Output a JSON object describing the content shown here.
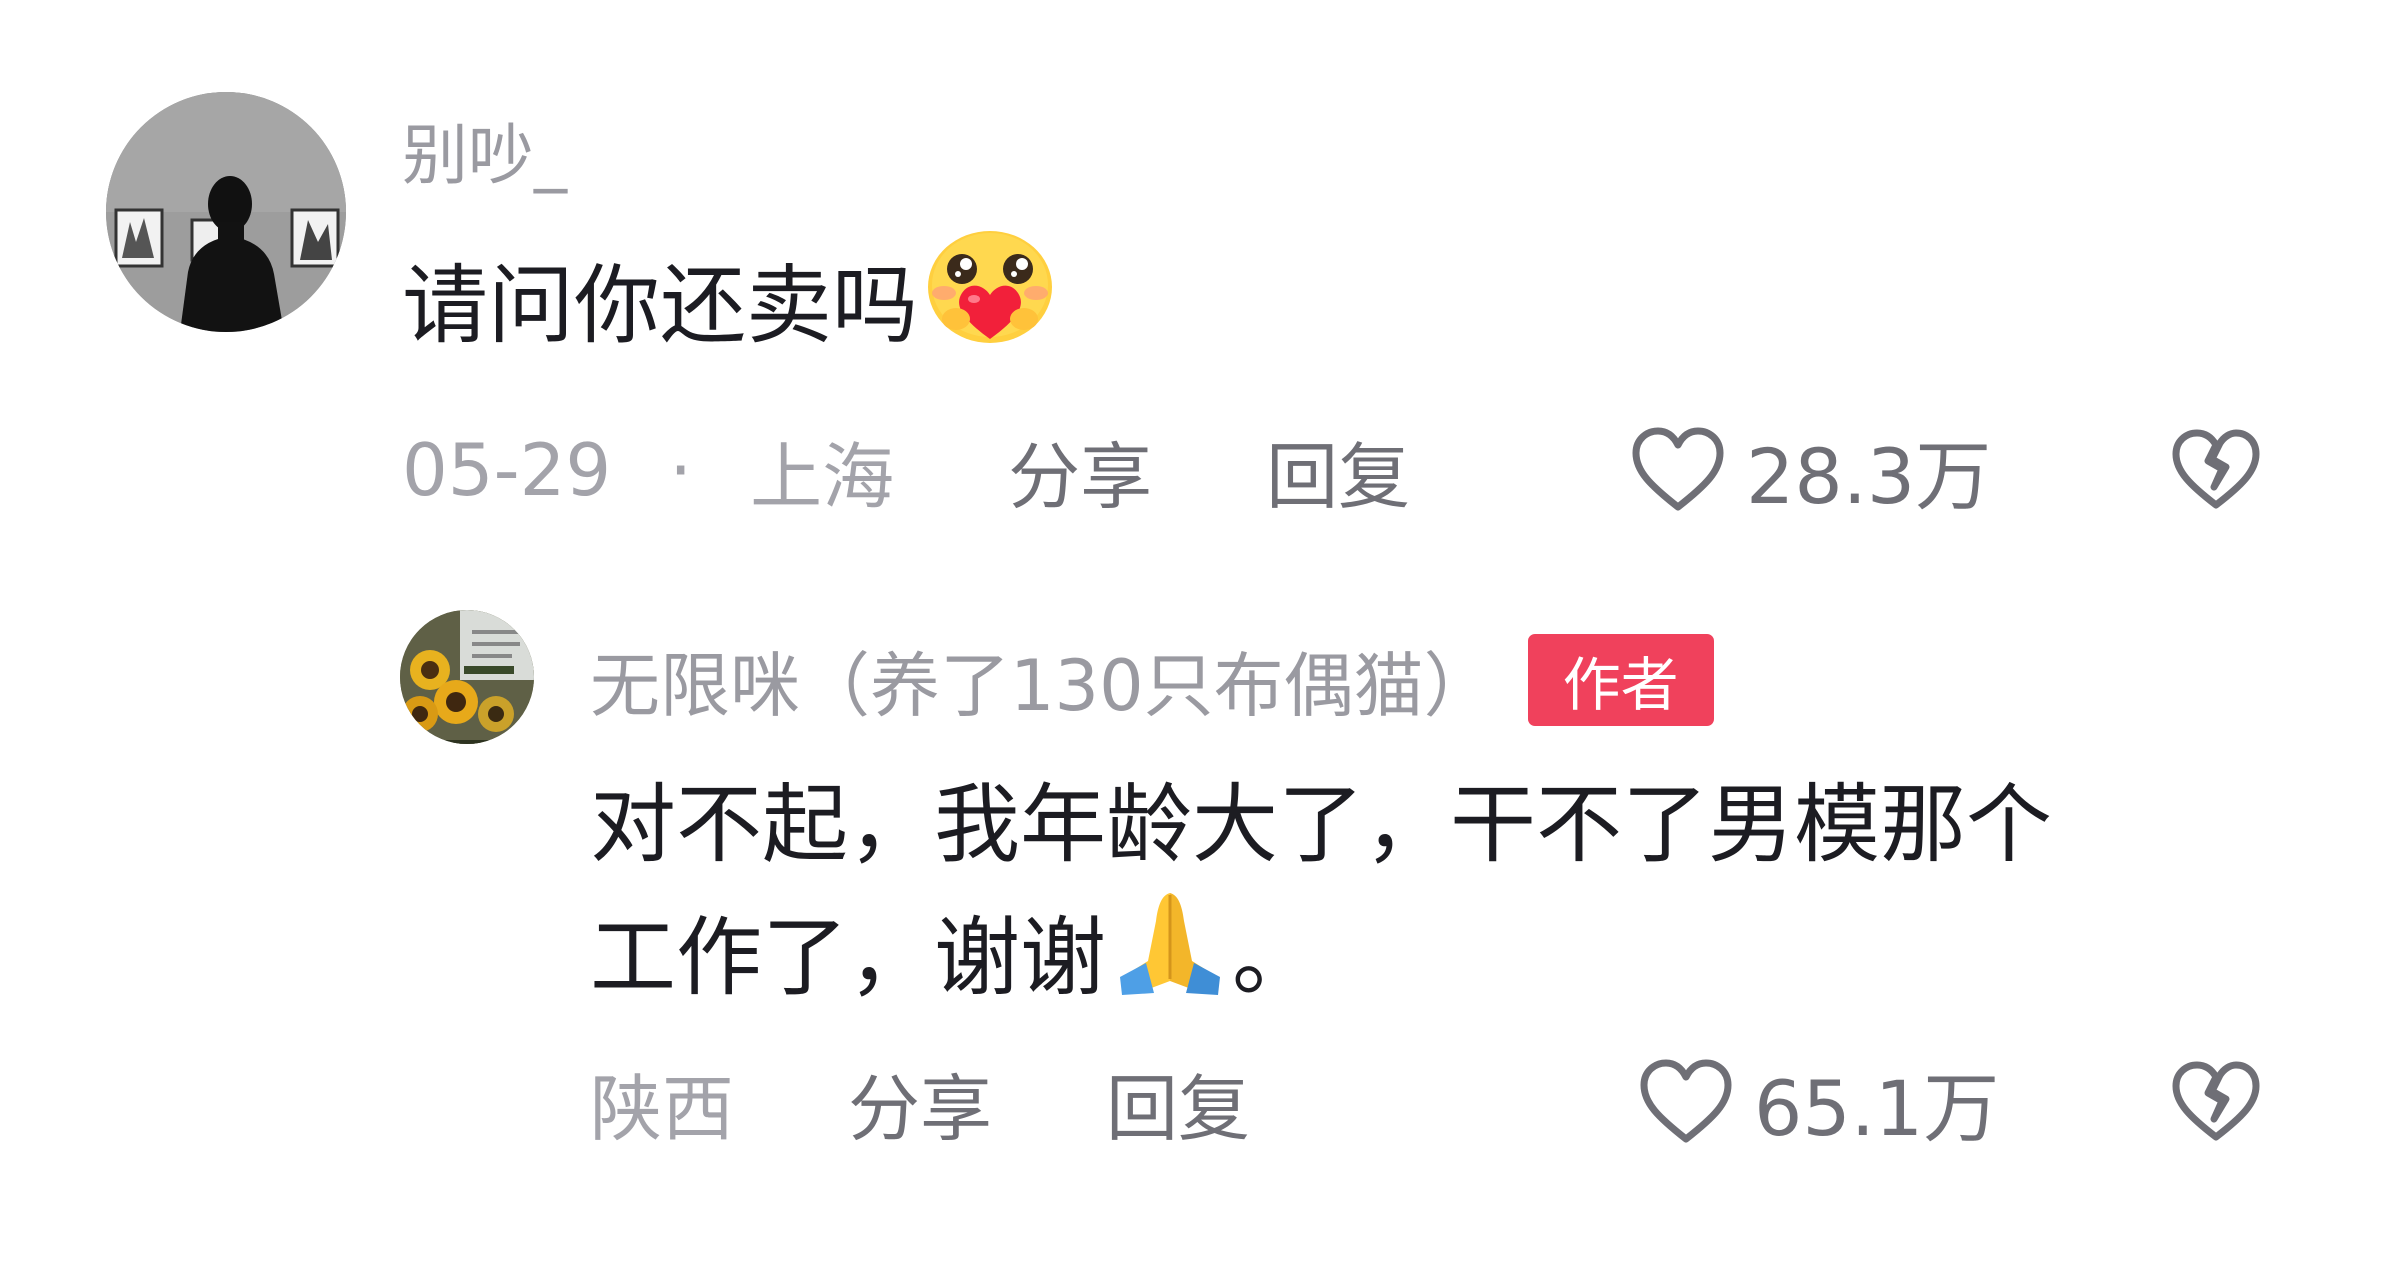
{
  "comment": {
    "username": "别吵_",
    "text": "请问你还卖吗",
    "date": "05-29",
    "separator": "·",
    "location": "上海",
    "share_label": "分享",
    "reply_label": "回复",
    "likes": "28.3万",
    "emoji": "hugging-heart-emoji",
    "avatar": "silhouette-gallery-avatar"
  },
  "reply": {
    "username": "无限咪（养了130只布偶猫）",
    "author_badge": "作者",
    "text_line1": "对不起，我年龄大了，干不了男模那个",
    "text_line2": "工作了，谢谢",
    "text_end": "。",
    "emoji": "folded-hands-emoji",
    "location": "陕西",
    "share_label": "分享",
    "reply_label": "回复",
    "likes": "65.1万",
    "avatar": "sunflower-avatar"
  },
  "colors": {
    "badge": "#f0415c",
    "meta": "#a3a3aa",
    "action": "#6f6f76",
    "text": "#1c1c22"
  }
}
